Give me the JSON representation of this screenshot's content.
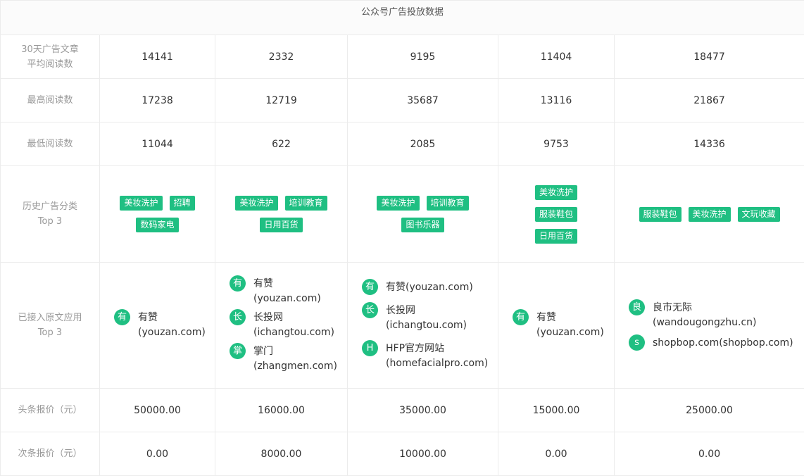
{
  "title": "公众号广告投放数据",
  "rows": {
    "avg_read": {
      "label_line1": "30天广告文章",
      "label_line2": "平均阅读数",
      "values": [
        "14141",
        "2332",
        "9195",
        "11404",
        "18477"
      ]
    },
    "max_read": {
      "label": "最高阅读数",
      "values": [
        "17238",
        "12719",
        "35687",
        "13116",
        "21867"
      ]
    },
    "min_read": {
      "label": "最低阅读数",
      "values": [
        "11044",
        "622",
        "2085",
        "9753",
        "14336"
      ]
    },
    "categories": {
      "label_line1": "历史广告分类",
      "label_line2": "Top 3",
      "cols": [
        [
          "美妆洗护",
          "招聘",
          "数码家电"
        ],
        [
          "美妆洗护",
          "培训教育",
          "日用百货"
        ],
        [
          "美妆洗护",
          "培训教育",
          "图书乐器"
        ],
        [
          "美妆洗护",
          "服装鞋包",
          "日用百货"
        ],
        [
          "服装鞋包",
          "美妆洗护",
          "文玩收藏"
        ]
      ]
    },
    "apps": {
      "label_line1": "已接入原文应用",
      "label_line2": "Top 3",
      "cols": [
        [
          {
            "icon": "有",
            "name": "有赞",
            "domain": "(youzan.com)"
          }
        ],
        [
          {
            "icon": "有",
            "name": "有赞",
            "domain": "(youzan.com)"
          },
          {
            "icon": "长",
            "name": "长投网",
            "domain": "(ichangtou.com)"
          },
          {
            "icon": "掌",
            "name": "掌门",
            "domain": "(zhangmen.com)"
          }
        ],
        [
          {
            "icon": "有",
            "name": "有赞(youzan.com)",
            "domain": ""
          },
          {
            "icon": "长",
            "name": "长投网",
            "domain": "(ichangtou.com)"
          },
          {
            "icon": "H",
            "name": "HFP官方网站",
            "domain": "(homefacialpro.com)"
          }
        ],
        [
          {
            "icon": "有",
            "name": "有赞",
            "domain": "(youzan.com)"
          }
        ],
        [
          {
            "icon": "良",
            "name": "良市无际",
            "domain": "(wandougongzhu.cn)"
          },
          {
            "icon": "s",
            "name": "shopbop.com(shopbop.com)",
            "domain": ""
          }
        ]
      ]
    },
    "headline_price": {
      "label": "头条报价（元）",
      "values": [
        "50000.00",
        "16000.00",
        "35000.00",
        "15000.00",
        "25000.00"
      ]
    },
    "second_price": {
      "label": "次条报价（元）",
      "values": [
        "0.00",
        "8000.00",
        "10000.00",
        "0.00",
        "0.00"
      ]
    }
  },
  "colors": {
    "accent": "#1fbf82",
    "label": "#999999",
    "border": "#ececec"
  }
}
